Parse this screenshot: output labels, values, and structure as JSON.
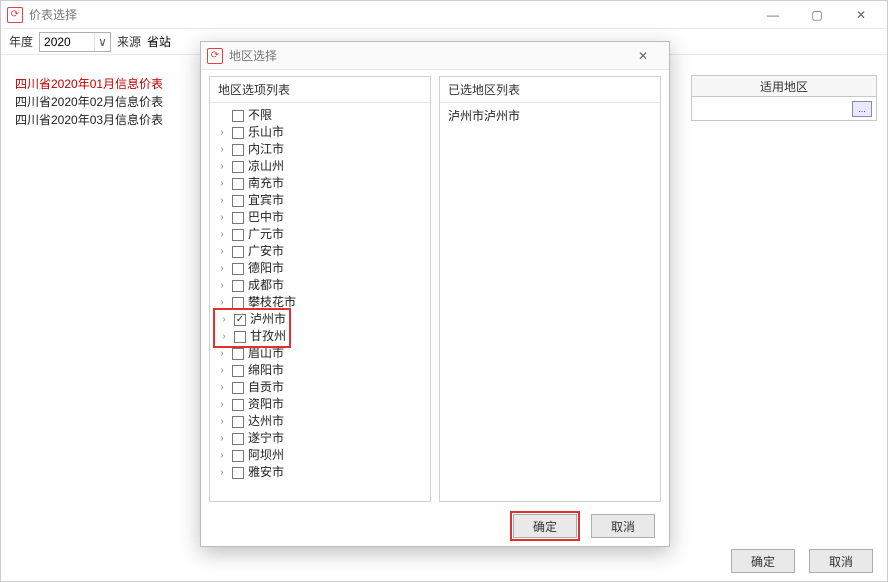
{
  "parent": {
    "title": "价表选择",
    "year_label": "年度",
    "year_value": "2020",
    "source_label": "来源",
    "source_value": "省站",
    "rows": [
      {
        "text": "四川省2020年01月信息价表",
        "red": true
      },
      {
        "text": "四川省2020年02月信息价表",
        "red": false
      },
      {
        "text": "四川省2020年03月信息价表",
        "red": false
      }
    ],
    "area_header": "适用地区",
    "ok": "确定",
    "cancel": "取消"
  },
  "dialog": {
    "title": "地区选择",
    "options_head": "地区选项列表",
    "selected_head": "已选地区列表",
    "items": [
      {
        "label": "不限",
        "checked": false,
        "expand": false
      },
      {
        "label": "乐山市",
        "checked": false,
        "expand": true
      },
      {
        "label": "内江市",
        "checked": false,
        "expand": true
      },
      {
        "label": "凉山州",
        "checked": false,
        "expand": true
      },
      {
        "label": "南充市",
        "checked": false,
        "expand": true
      },
      {
        "label": "宜宾市",
        "checked": false,
        "expand": true
      },
      {
        "label": "巴中市",
        "checked": false,
        "expand": true
      },
      {
        "label": "广元市",
        "checked": false,
        "expand": true
      },
      {
        "label": "广安市",
        "checked": false,
        "expand": true
      },
      {
        "label": "德阳市",
        "checked": false,
        "expand": true
      },
      {
        "label": "成都市",
        "checked": false,
        "expand": true
      },
      {
        "label": "攀枝花市",
        "checked": false,
        "expand": true
      },
      {
        "label": "泸州市",
        "checked": true,
        "expand": true,
        "hl": true
      },
      {
        "label": "甘孜州",
        "checked": false,
        "expand": true,
        "hl": true
      },
      {
        "label": "眉山市",
        "checked": false,
        "expand": true
      },
      {
        "label": "绵阳市",
        "checked": false,
        "expand": true
      },
      {
        "label": "自贡市",
        "checked": false,
        "expand": true
      },
      {
        "label": "资阳市",
        "checked": false,
        "expand": true
      },
      {
        "label": "达州市",
        "checked": false,
        "expand": true
      },
      {
        "label": "遂宁市",
        "checked": false,
        "expand": true
      },
      {
        "label": "阿坝州",
        "checked": false,
        "expand": true
      },
      {
        "label": "雅安市",
        "checked": false,
        "expand": true
      }
    ],
    "selected_value": "泸州市泸州市",
    "ok": "确定",
    "cancel": "取消"
  },
  "icons": {
    "app": "⟳",
    "min": "—",
    "max": "▢",
    "close": "✕",
    "caret": "∨",
    "expand": "›",
    "ellipsis": "..."
  }
}
